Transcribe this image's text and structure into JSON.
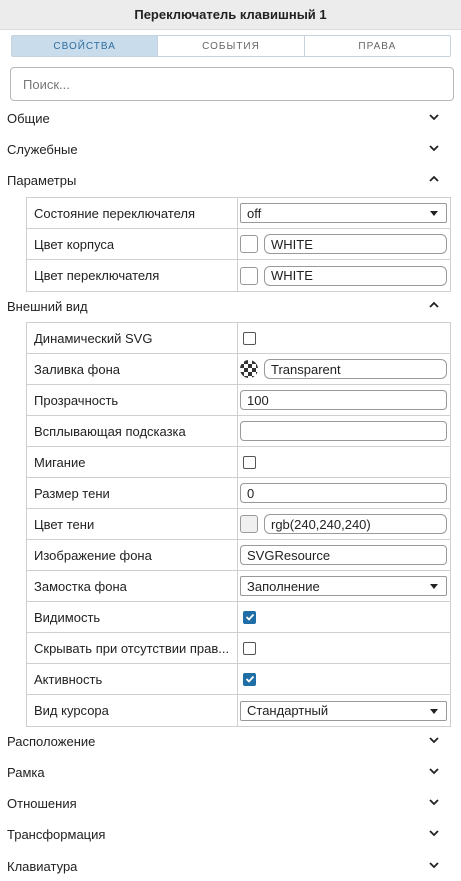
{
  "title": "Переключатель клавишный 1",
  "tabs": [
    "СВОЙСТВА",
    "СОБЫТИЯ",
    "ПРАВА"
  ],
  "search_placeholder": "Поиск...",
  "sections": {
    "general": "Общие",
    "service": "Служебные",
    "parameters": "Параметры",
    "appearance": "Внешний вид",
    "position": "Расположение",
    "frame": "Рамка",
    "relations": "Отношения",
    "transform": "Трансформация",
    "keyboard": "Клавиатура"
  },
  "parameters": {
    "switch_state": {
      "label": "Состояние переключателя",
      "value": "off"
    },
    "body_color": {
      "label": "Цвет корпуса",
      "value": "WHITE"
    },
    "switch_color": {
      "label": "Цвет переключателя",
      "value": "WHITE"
    }
  },
  "appearance": {
    "dynamic_svg": {
      "label": "Динамический SVG",
      "checked": false
    },
    "bg_fill": {
      "label": "Заливка фона",
      "value": "Transparent"
    },
    "opacity": {
      "label": "Прозрачность",
      "value": "100"
    },
    "tooltip": {
      "label": "Всплывающая подсказка",
      "value": ""
    },
    "blink": {
      "label": "Мигание",
      "checked": false
    },
    "shadow_size": {
      "label": "Размер тени",
      "value": "0"
    },
    "shadow_color": {
      "label": "Цвет тени",
      "value": "rgb(240,240,240)"
    },
    "bg_image": {
      "label": "Изображение фона",
      "value": "SVGResource"
    },
    "bg_tiling": {
      "label": "Замостка фона",
      "value": "Заполнение"
    },
    "visibility": {
      "label": "Видимость",
      "checked": true
    },
    "hide_no_rights": {
      "label": "Скрывать при отсутствии прав...",
      "checked": false
    },
    "active": {
      "label": "Активность",
      "checked": true
    },
    "cursor": {
      "label": "Вид курсора",
      "value": "Стандартный"
    }
  },
  "colors": {
    "accent": "#1f6fa6",
    "tab_active_bg": "#c9dcec"
  }
}
